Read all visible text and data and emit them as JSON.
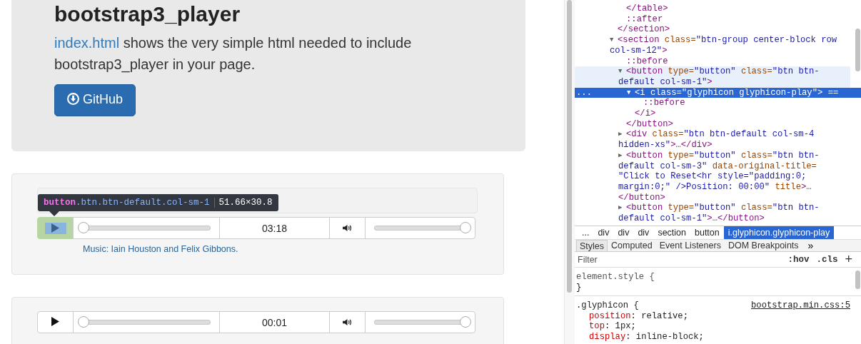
{
  "jumbotron": {
    "title": "bootstrap3_player",
    "link": "index.html",
    "text": " shows the very simple html needed to include bootstrap3_player in your page.",
    "button": "GitHub"
  },
  "inspect_tooltip": {
    "tag": "button",
    "classes": ".btn.btn-default.col-sm-1",
    "size": "51.66×30.8"
  },
  "players": [
    {
      "inspected": true,
      "seek": {
        "level": 0
      },
      "time": "03:18",
      "volume": {
        "level": 1
      },
      "caption": "Music: Iain Houston and Felix Gibbons."
    },
    {
      "inspected": false,
      "seek": {
        "level": 0
      },
      "time": "00:01",
      "volume": {
        "level": 1
      }
    }
  ],
  "dom_tree": {
    "selected_marker": "...",
    "nodes": [
      {
        "children": [
          {
            "lines": [
              [
                {
                  "kind": "tag",
                  "t": "</table>"
                }
              ]
            ]
          },
          {
            "lines": [
              [
                {
                  "kind": "pseudo",
                  "t": "::after"
                }
              ]
            ]
          }
        ]
      },
      {
        "lines": [
          [
            {
              "kind": "tag",
              "t": "</section>"
            }
          ]
        ]
      },
      {
        "toggle": "▼",
        "lines": [
          [
            {
              "kind": "tag",
              "t": "<section"
            },
            {
              "kind": "attr",
              "t": " class="
            },
            {
              "kind": "val",
              "t": "\"btn-group center-block row"
            }
          ],
          [
            {
              "kind": "val",
              "t": "col-sm-12\""
            },
            {
              "kind": "tag",
              "t": ">"
            }
          ]
        ],
        "children": [
          {
            "lines": [
              [
                {
                  "kind": "pseudo",
                  "t": "::before"
                }
              ]
            ]
          },
          {
            "toggle": "▼",
            "hovered": true,
            "lines": [
              [
                {
                  "kind": "tag",
                  "t": "<button"
                },
                {
                  "kind": "attr",
                  "t": " type="
                },
                {
                  "kind": "val",
                  "t": "\"button\""
                },
                {
                  "kind": "attr",
                  "t": " class="
                },
                {
                  "kind": "val",
                  "t": "\"btn btn-"
                }
              ],
              [
                {
                  "kind": "val",
                  "t": "default col-sm-1\""
                },
                {
                  "kind": "tag",
                  "t": ">"
                }
              ]
            ],
            "children": [
              {
                "toggle": "▼",
                "selected": true,
                "lines": [
                  [
                    {
                      "kind": "tag",
                      "t": "<i"
                    },
                    {
                      "kind": "attr",
                      "t": " class="
                    },
                    {
                      "kind": "val",
                      "t": "\"glyphicon glyphicon-play\""
                    },
                    {
                      "kind": "tag",
                      "t": ">"
                    },
                    {
                      "kind": "plain",
                      "t": " =="
                    }
                  ]
                ],
                "children": [
                  {
                    "lines": [
                      [
                        {
                          "kind": "pseudo",
                          "t": "::before"
                        }
                      ]
                    ]
                  }
                ]
              },
              {
                "lines": [
                  [
                    {
                      "kind": "tag",
                      "t": "</i>"
                    }
                  ]
                ]
              }
            ]
          },
          {
            "lines": [
              [
                {
                  "kind": "tag",
                  "t": "</button>"
                }
              ]
            ]
          },
          {
            "toggle": "▶",
            "lines": [
              [
                {
                  "kind": "tag",
                  "t": "<div"
                },
                {
                  "kind": "attr",
                  "t": " class="
                },
                {
                  "kind": "val",
                  "t": "\"btn btn-default col-sm-4"
                }
              ],
              [
                {
                  "kind": "val",
                  "t": "hidden-xs\""
                },
                {
                  "kind": "tag",
                  "t": ">"
                },
                {
                  "kind": "plain",
                  "t": "…"
                },
                {
                  "kind": "tag",
                  "t": "</div>"
                }
              ]
            ]
          },
          {
            "toggle": "▶",
            "lines": [
              [
                {
                  "kind": "tag",
                  "t": "<button"
                },
                {
                  "kind": "attr",
                  "t": " type="
                },
                {
                  "kind": "val",
                  "t": "\"button\""
                },
                {
                  "kind": "attr",
                  "t": " class="
                },
                {
                  "kind": "val",
                  "t": "\"btn btn-"
                }
              ],
              [
                {
                  "kind": "val",
                  "t": "default col-sm-3\""
                },
                {
                  "kind": "attr",
                  "t": " data-original-title="
                }
              ],
              [
                {
                  "kind": "val",
                  "t": "\"Click to Reset<hr style=\"padding:0;"
                }
              ],
              [
                {
                  "kind": "val",
                  "t": "margin:0;\" />Position: 00:00\""
                },
                {
                  "kind": "attr",
                  "t": " title"
                },
                {
                  "kind": "tag",
                  "t": ">"
                },
                {
                  "kind": "plain",
                  "t": "…"
                }
              ],
              [
                {
                  "kind": "tag",
                  "t": "</button>"
                }
              ]
            ]
          },
          {
            "toggle": "▶",
            "lines": [
              [
                {
                  "kind": "tag",
                  "t": "<button"
                },
                {
                  "kind": "attr",
                  "t": " type="
                },
                {
                  "kind": "val",
                  "t": "\"button\""
                },
                {
                  "kind": "attr",
                  "t": " class="
                },
                {
                  "kind": "val",
                  "t": "\"btn btn-"
                }
              ],
              [
                {
                  "kind": "val",
                  "t": "default col-sm-1\""
                },
                {
                  "kind": "tag",
                  "t": ">"
                },
                {
                  "kind": "plain",
                  "t": "…"
                },
                {
                  "kind": "tag",
                  "t": "</button>"
                }
              ]
            ]
          }
        ]
      }
    ]
  },
  "breadcrumbs": [
    {
      "label": "...",
      "selected": false
    },
    {
      "label": "div",
      "selected": false
    },
    {
      "label": "div",
      "selected": false
    },
    {
      "label": "div",
      "selected": false
    },
    {
      "label": "section",
      "selected": false
    },
    {
      "label": "button",
      "selected": false
    },
    {
      "label": "i.glyphicon.glyphicon-play",
      "selected": true
    }
  ],
  "tabs": [
    {
      "label": "Styles",
      "selected": true
    },
    {
      "label": "Computed",
      "selected": false
    },
    {
      "label": "Event Listeners",
      "selected": false
    },
    {
      "label": "DOM Breakpoints",
      "selected": false
    }
  ],
  "tabs_overflow": "»",
  "filter": {
    "placeholder": "Filter",
    "hov": ":hov",
    "cls": ".cls",
    "add": "+"
  },
  "rules": [
    {
      "selector": "element.style {",
      "close": "}"
    },
    {
      "selector": ".glyphicon {",
      "source": "bootstrap.min.css:5",
      "props": [
        {
          "name": "position",
          "value": ": relative;"
        },
        {
          "name": "top",
          "value": ": 1px;"
        },
        {
          "name": "display",
          "value": ": inline-block;"
        }
      ]
    }
  ]
}
